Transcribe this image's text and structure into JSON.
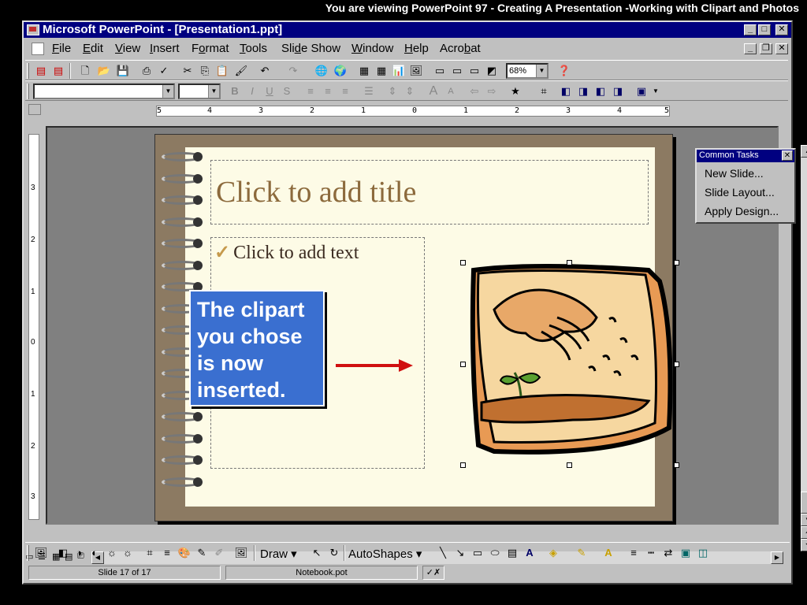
{
  "tutorial_banner": "You are viewing PowerPoint 97 -  Creating A Presentation -Working with Clipart and Photos",
  "window": {
    "title": "Microsoft PowerPoint - [Presentation1.ppt]"
  },
  "menu": {
    "items": [
      {
        "label": "File",
        "accel": "F",
        "rest": "ile"
      },
      {
        "label": "Edit",
        "accel": "E",
        "rest": "dit"
      },
      {
        "label": "View",
        "accel": "V",
        "rest": "iew"
      },
      {
        "label": "Insert",
        "accel": "I",
        "rest": "nsert"
      },
      {
        "label": "Format",
        "accel": "F",
        "rest": "ormat",
        "prefix": ""
      },
      {
        "label": "Tools",
        "accel": "T",
        "rest": "ools"
      },
      {
        "label": "Slide Show",
        "prefix": "Sli",
        "accel": "d",
        "rest": "e Show"
      },
      {
        "label": "Window",
        "accel": "W",
        "rest": "indow"
      },
      {
        "label": "Help",
        "accel": "H",
        "rest": "elp"
      },
      {
        "label": "Acrobat",
        "prefix": "Acro",
        "accel": "b",
        "rest": "at"
      }
    ]
  },
  "toolbar": {
    "zoom": "68%"
  },
  "ruler": {
    "h_labels": [
      "5",
      "4",
      "3",
      "2",
      "1",
      "0",
      "1",
      "2",
      "3",
      "4",
      "5"
    ],
    "v_labels": [
      "3",
      "2",
      "1",
      "0",
      "1",
      "2",
      "3"
    ]
  },
  "slide": {
    "title_placeholder": "Click to add title",
    "bullet": "✓",
    "body_placeholder": "Click to add text"
  },
  "callout": {
    "text": "The clipart you chose is now inserted."
  },
  "common_tasks": {
    "title": "Common Tasks",
    "items": [
      "New Slide...",
      "Slide Layout...",
      "Apply Design..."
    ]
  },
  "drawing_toolbar": {
    "draw_label": "Draw",
    "autoshapes_label": "AutoShapes"
  },
  "status": {
    "slide": "Slide 17 of 17",
    "template": "Notebook.pot"
  },
  "colors": {
    "title_bar": "#000080",
    "callout": "#3a6fd0",
    "arrow": "#d01010",
    "slide_title": "#8c6a3c"
  }
}
